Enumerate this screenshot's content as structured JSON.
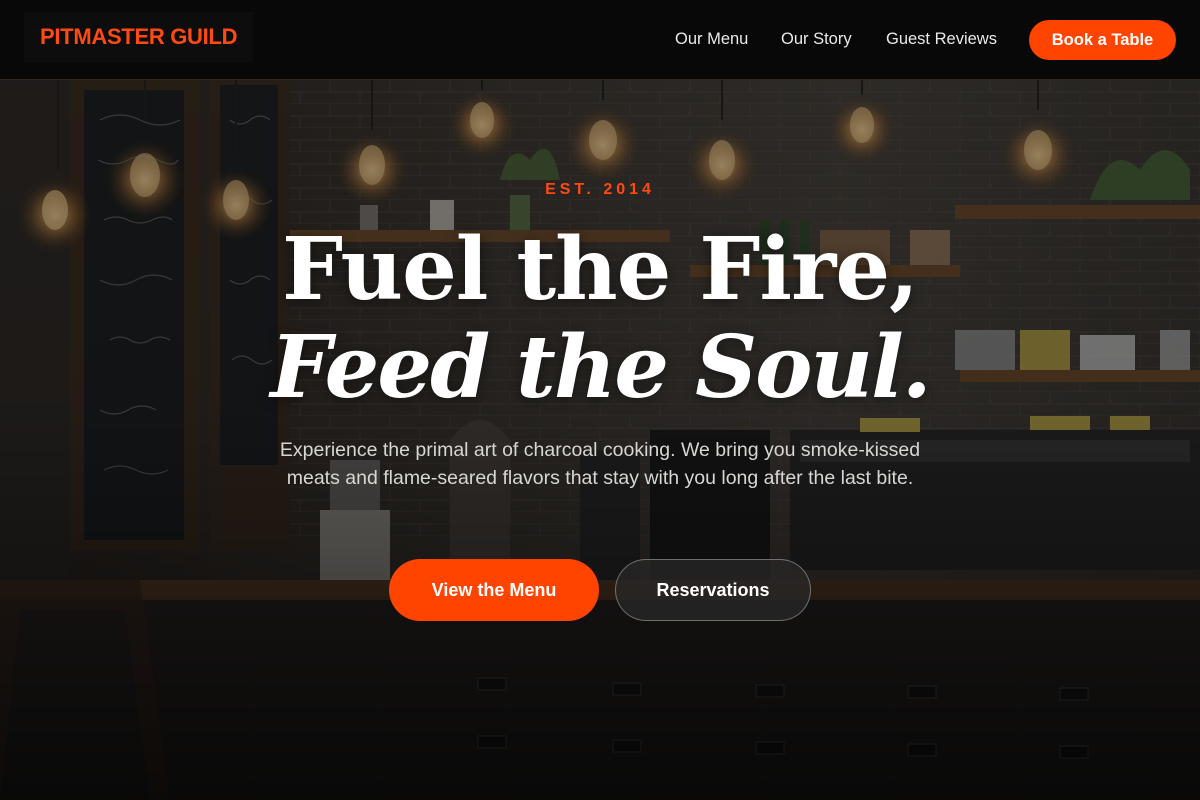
{
  "nav": {
    "brand": "PITMASTER GUILD",
    "links": [
      "Our Menu",
      "Our Story",
      "Guest Reviews"
    ],
    "cta": "Book a Table"
  },
  "hero": {
    "eyebrow": "EST. 2014",
    "headline_line1": "Fuel the Fire,",
    "headline_line2": "Feed the Soul.",
    "subtext": "Experience the primal art of charcoal cooking. We bring you smoke-kissed meats and flame-seared flavors that stay with you long after the last bite.",
    "primary_button": "View the Menu",
    "secondary_button": "Reservations"
  },
  "colors": {
    "accent": "#ff4400",
    "brand_text": "#ff4a12",
    "nav_background": "#080808"
  }
}
